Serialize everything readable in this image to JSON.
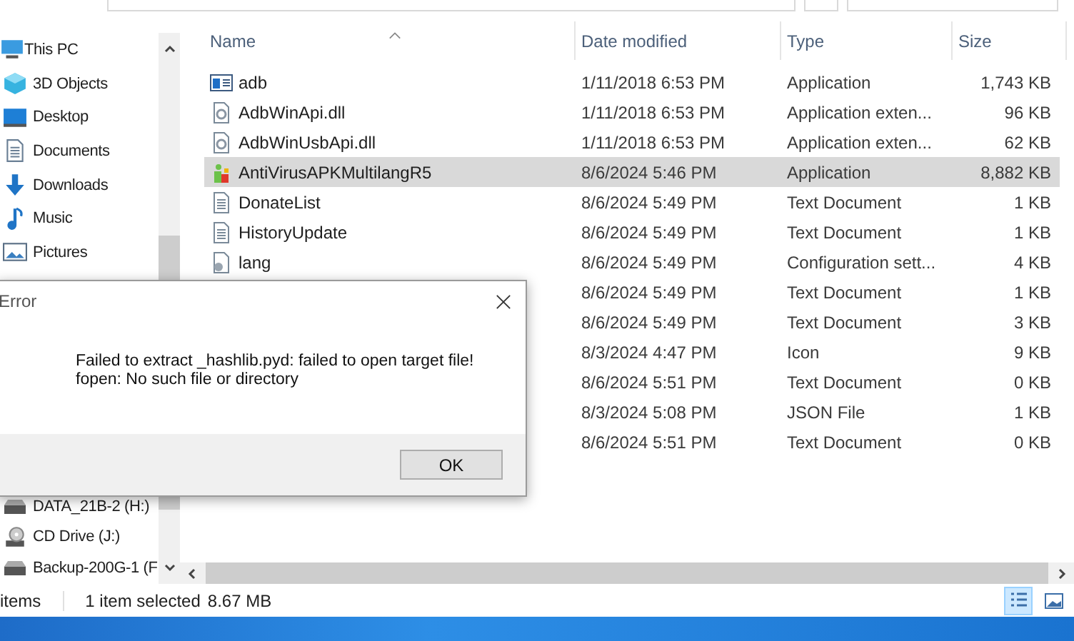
{
  "sidebar": {
    "items": [
      {
        "label": "This PC",
        "kind": "pc",
        "children": [
          {
            "label": "3D Objects",
            "kind": "cube"
          },
          {
            "label": "Desktop",
            "kind": "desktop"
          },
          {
            "label": "Documents",
            "kind": "documents"
          },
          {
            "label": "Downloads",
            "kind": "downloads"
          },
          {
            "label": "Music",
            "kind": "music"
          },
          {
            "label": "Pictures",
            "kind": "pictures"
          }
        ]
      }
    ],
    "lower_items": [
      {
        "label": "DATA_21B-2 (H:)",
        "kind": "drive"
      },
      {
        "label": "CD Drive (J:)",
        "kind": "cd"
      },
      {
        "label": "Backup-200G-1 (F",
        "kind": "drive"
      }
    ]
  },
  "table": {
    "columns": [
      "Name",
      "Date modified",
      "Type",
      "Size"
    ],
    "rows": [
      {
        "name": "adb",
        "kind": "app",
        "date": "1/11/2018 6:53 PM",
        "type": "Application",
        "size": "1,743 KB",
        "selected": false
      },
      {
        "name": "AdbWinApi.dll",
        "kind": "dll",
        "date": "1/11/2018 6:53 PM",
        "type": "Application exten...",
        "size": "96 KB",
        "selected": false
      },
      {
        "name": "AdbWinUsbApi.dll",
        "kind": "dll",
        "date": "1/11/2018 6:53 PM",
        "type": "Application exten...",
        "size": "62 KB",
        "selected": false
      },
      {
        "name": "AntiVirusAPKMultilangR5",
        "kind": "antivirus",
        "date": "8/6/2024 5:46 PM",
        "type": "Application",
        "size": "8,882 KB",
        "selected": true
      },
      {
        "name": "DonateList",
        "kind": "text",
        "date": "8/6/2024 5:49 PM",
        "type": "Text Document",
        "size": "1 KB",
        "selected": false
      },
      {
        "name": "HistoryUpdate",
        "kind": "text",
        "date": "8/6/2024 5:49 PM",
        "type": "Text Document",
        "size": "1 KB",
        "selected": false
      },
      {
        "name": "lang",
        "kind": "config",
        "date": "8/6/2024 5:49 PM",
        "type": "Configuration sett...",
        "size": "4 KB",
        "selected": false
      },
      {
        "date": "8/6/2024 5:49 PM",
        "type": "Text Document",
        "size": "1 KB",
        "selected": false
      },
      {
        "date": "8/6/2024 5:49 PM",
        "type": "Text Document",
        "size": "3 KB",
        "selected": false
      },
      {
        "date": "8/3/2024 4:47 PM",
        "type": "Icon",
        "size": "9 KB",
        "selected": false
      },
      {
        "date": "8/6/2024 5:51 PM",
        "type": "Text Document",
        "size": "0 KB",
        "selected": false
      },
      {
        "date": "8/3/2024 5:08 PM",
        "type": "JSON File",
        "size": "1 KB",
        "selected": false
      },
      {
        "date": "8/6/2024 5:51 PM",
        "type": "Text Document",
        "size": "0 KB",
        "selected": false
      }
    ]
  },
  "status_bar": {
    "item_count": "items",
    "selection": "1 item selected",
    "selection_size": "8.67 MB",
    "details_view_selected": true
  },
  "dialog": {
    "title": "Error",
    "message_lines": [
      "Failed to extract _hashlib.pyd: failed to open target file!",
      "fopen: No such file or directory"
    ],
    "button": "OK"
  }
}
